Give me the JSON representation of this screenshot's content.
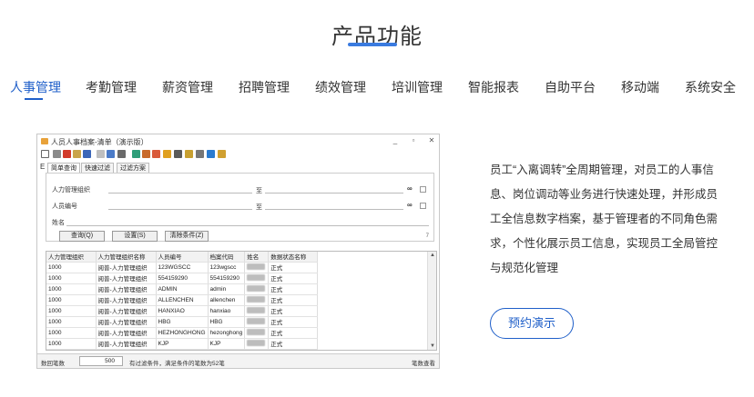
{
  "section_title": "产品功能",
  "tabs": [
    {
      "label": "人事管理",
      "active": true
    },
    {
      "label": "考勤管理",
      "active": false
    },
    {
      "label": "薪资管理",
      "active": false
    },
    {
      "label": "招聘管理",
      "active": false
    },
    {
      "label": "绩效管理",
      "active": false
    },
    {
      "label": "培训管理",
      "active": false
    },
    {
      "label": "智能报表",
      "active": false
    },
    {
      "label": "自助平台",
      "active": false
    },
    {
      "label": "移动端",
      "active": false
    },
    {
      "label": "系统安全",
      "active": false
    }
  ],
  "app_window": {
    "title": "人员人事档案-清单（演示版）",
    "controls": [
      "_",
      "▫",
      "✕"
    ],
    "filter_tabs_prefix": "E",
    "filter_tabs": [
      "简单查询",
      "快速过滤",
      "过滤方案"
    ],
    "filter": {
      "fields": [
        "人力管理组织",
        "人员编号",
        "姓名"
      ],
      "to_label": "至",
      "buttons": [
        "查询(Q)",
        "设置(S)",
        "清除条件(Z)"
      ],
      "count": "7"
    },
    "grid": {
      "columns": [
        "人力管理组织",
        "人力管理组织名称",
        "人员编号",
        "档案代码",
        "姓名",
        "数据状态名称"
      ],
      "rows": [
        [
          "1000",
          "阅普-人力管理组织",
          "123WGSCC",
          "123wgscc",
          "",
          "正式"
        ],
        [
          "1000",
          "阅普-人力管理组织",
          "554159290",
          "554159290",
          "",
          "正式"
        ],
        [
          "1000",
          "阅普-人力管理组织",
          "ADMIN",
          "admin",
          "",
          "正式"
        ],
        [
          "1000",
          "阅普-人力管理组织",
          "ALLENCHEN",
          "allenchen",
          "",
          "正式"
        ],
        [
          "1000",
          "阅普-人力管理组织",
          "HANXIAO",
          "hanxiao",
          "",
          "正式"
        ],
        [
          "1000",
          "阅普-人力管理组织",
          "HBG",
          "HBG",
          "",
          "正式"
        ],
        [
          "1000",
          "阅普-人力管理组织",
          "HEZHONGHONG",
          "hezonghong",
          "",
          "正式"
        ],
        [
          "1000",
          "阅普-人力管理组织",
          "KJP",
          "KJP",
          "",
          "正式"
        ]
      ]
    },
    "status": {
      "fetch_label": "数回笔数",
      "fetch_value": "500",
      "info": "有过滤条件，满足条件的笔数为52笔",
      "right": "笔数查看"
    }
  },
  "description": "员工“入离调转”全周期管理，对员工的人事信息、岗位调动等业务进行快速处理，并形成员工全信息数字档案，基于管理者的不同角色需求，个性化展示员工信息，实现员工全局管控与规范化管理",
  "demo_button": "预约演示",
  "colors": {
    "accent": "#1f5fc9",
    "underline": "#3a7be0"
  }
}
